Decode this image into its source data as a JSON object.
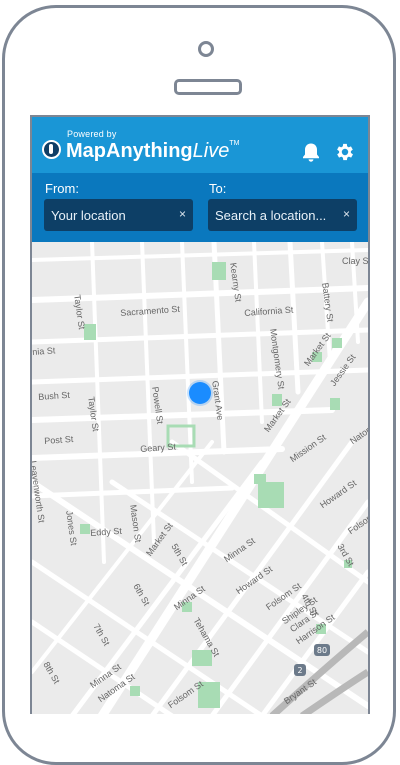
{
  "header": {
    "powered_by": "Powered by",
    "brand_main": "MapAnything",
    "brand_live": "Live",
    "brand_tm": "TM",
    "bell_icon": "bell-icon",
    "settings_icon": "gear-icon"
  },
  "search": {
    "from_label": "From:",
    "to_label": "To:",
    "from_value": "Your location",
    "to_placeholder": "Search a location...",
    "clear_glyph": "×"
  },
  "map": {
    "streets": [
      {
        "text": "Clay S"
      },
      {
        "text": "Kearny St"
      },
      {
        "text": "California St"
      },
      {
        "text": "Battery St"
      },
      {
        "text": "Sacramento St"
      },
      {
        "text": "Taylor St"
      },
      {
        "text": "nia St"
      },
      {
        "text": "Montgomery St"
      },
      {
        "text": "Market St"
      },
      {
        "text": "Bush St"
      },
      {
        "text": "Powell St"
      },
      {
        "text": "Taylor St"
      },
      {
        "text": "Grant Ave"
      },
      {
        "text": "Jessie St"
      },
      {
        "text": "Post St"
      },
      {
        "text": "Market St"
      },
      {
        "text": "Geary St"
      },
      {
        "text": "Mission St"
      },
      {
        "text": "Natom"
      },
      {
        "text": "Leavenworth St"
      },
      {
        "text": "Howard St"
      },
      {
        "text": "Jones St"
      },
      {
        "text": "Eddy St"
      },
      {
        "text": "Mason St"
      },
      {
        "text": "Market St"
      },
      {
        "text": "5th St"
      },
      {
        "text": "Minna St"
      },
      {
        "text": "Folsom"
      },
      {
        "text": "3rd St"
      },
      {
        "text": "Howard St"
      },
      {
        "text": "Minna St"
      },
      {
        "text": "6th St"
      },
      {
        "text": "Tehama St"
      },
      {
        "text": "Folsom St"
      },
      {
        "text": "Shipley St"
      },
      {
        "text": "Clara St"
      },
      {
        "text": "Harrison St"
      },
      {
        "text": "4th St"
      },
      {
        "text": "7th St"
      },
      {
        "text": "8th St"
      },
      {
        "text": "Minna St"
      },
      {
        "text": "Natoma St"
      },
      {
        "text": "Folsom St"
      },
      {
        "text": "Bryant St"
      }
    ],
    "route_shields": [
      "80",
      "2"
    ]
  }
}
